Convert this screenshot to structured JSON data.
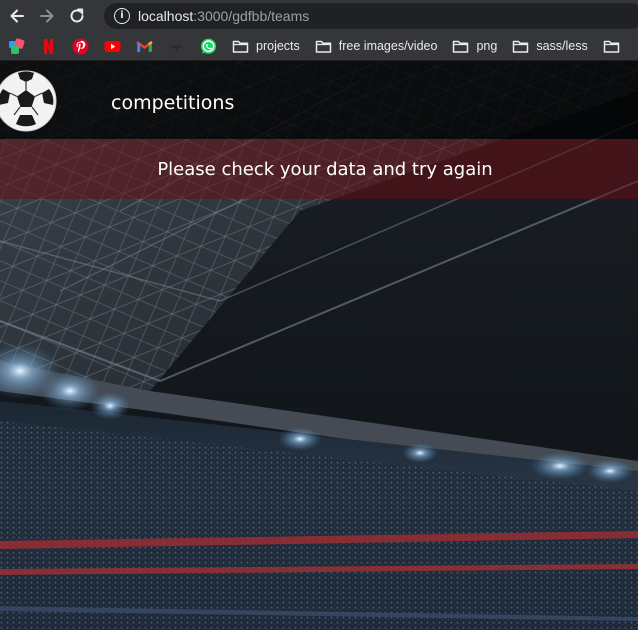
{
  "browser": {
    "url_host": "localhost",
    "url_path": ":3000/gdfbb/teams",
    "bookmarks": [
      {
        "icon": "cloud-app-icon",
        "label": ""
      },
      {
        "icon": "netflix-icon",
        "label": ""
      },
      {
        "icon": "pinterest-icon",
        "label": ""
      },
      {
        "icon": "youtube-icon",
        "label": ""
      },
      {
        "icon": "gmail-icon",
        "label": ""
      },
      {
        "icon": "medium-icon",
        "label": ""
      },
      {
        "icon": "whatsapp-icon",
        "label": ""
      },
      {
        "icon": "folder-icon",
        "label": "projects"
      },
      {
        "icon": "folder-icon",
        "label": "free images/video"
      },
      {
        "icon": "folder-icon",
        "label": "png"
      },
      {
        "icon": "folder-icon",
        "label": "sass/less"
      },
      {
        "icon": "folder-icon",
        "label": ""
      }
    ]
  },
  "header": {
    "logo": "soccer-ball-icon",
    "nav_label": "competitions"
  },
  "error": {
    "message": "Please check your data and try again"
  },
  "background": "stadium-photo",
  "colors": {
    "chrome": "#35363a",
    "omnibox": "#202124",
    "banner": "#690e12",
    "header": "#000000"
  }
}
